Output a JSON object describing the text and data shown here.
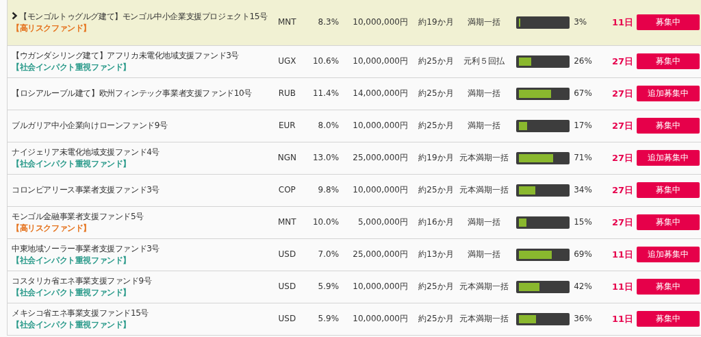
{
  "funds": [
    {
      "name": "【モンゴルトゥグルグ建て】モンゴル中小企業支援プロジェクト15号",
      "tag": {
        "kind": "high-risk",
        "text": "【高リスクファンド】"
      },
      "currency": "MNT",
      "rate": "8.3%",
      "amount": "10,000,000円",
      "period": "約19か月",
      "repayment": "満期一括",
      "level": 0.03,
      "percent": "3%",
      "days": "11日",
      "status": "募集中",
      "selected": true
    },
    {
      "name": "【ウガンダシリング建て】アフリカ未電化地域支援ファンド3号",
      "tag": {
        "kind": "social-impact",
        "text": "【社会インパクト重視ファンド】"
      },
      "currency": "UGX",
      "rate": "10.6%",
      "amount": "10,000,000円",
      "period": "約25か月",
      "repayment": "元利５回払",
      "level": 0.26,
      "percent": "26%",
      "days": "27日",
      "status": "募集中",
      "selected": false
    },
    {
      "name": "【ロシアルーブル建て】欧州フィンテック事業者支援ファンド10号",
      "currency": "RUB",
      "rate": "11.4%",
      "amount": "14,000,000円",
      "period": "約25か月",
      "repayment": "満期一括",
      "level": 0.67,
      "percent": "67%",
      "days": "27日",
      "status": "追加募集中",
      "selected": false
    },
    {
      "name": "ブルガリア中小企業向けローンファンド9号",
      "currency": "EUR",
      "rate": "8.0%",
      "amount": "10,000,000円",
      "period": "約25か月",
      "repayment": "満期一括",
      "level": 0.17,
      "percent": "17%",
      "days": "27日",
      "status": "募集中",
      "selected": false
    },
    {
      "name": "ナイジェリア未電化地域支援ファンド4号",
      "tag": {
        "kind": "social-impact",
        "text": "【社会インパクト重視ファンド】"
      },
      "currency": "NGN",
      "rate": "13.0%",
      "amount": "25,000,000円",
      "period": "約19か月",
      "repayment": "元本満期一括",
      "level": 0.71,
      "percent": "71%",
      "days": "27日",
      "status": "追加募集中",
      "selected": false
    },
    {
      "name": "コロンビアリース事業者支援ファンド3号",
      "currency": "COP",
      "rate": "9.8%",
      "amount": "10,000,000円",
      "period": "約25か月",
      "repayment": "元本満期一括",
      "level": 0.34,
      "percent": "34%",
      "days": "27日",
      "status": "募集中",
      "selected": false
    },
    {
      "name": "モンゴル金融事業者支援ファンド5号",
      "tag": {
        "kind": "high-risk",
        "text": "【高リスクファンド】"
      },
      "currency": "MNT",
      "rate": "10.0%",
      "amount": "5,000,000円",
      "period": "約16か月",
      "repayment": "満期一括",
      "level": 0.15,
      "percent": "15%",
      "days": "27日",
      "status": "募集中",
      "selected": false
    },
    {
      "name": "中東地域ソーラー事業者支援ファンド3号",
      "tag": {
        "kind": "social-impact",
        "text": "【社会インパクト重視ファンド】"
      },
      "currency": "USD",
      "rate": "7.0%",
      "amount": "25,000,000円",
      "period": "約13か月",
      "repayment": "満期一括",
      "level": 0.69,
      "percent": "69%",
      "days": "11日",
      "status": "追加募集中",
      "selected": false
    },
    {
      "name": "コスタリカ省エネ事業支援ファンド9号",
      "tag": {
        "kind": "social-impact",
        "text": "【社会インパクト重視ファンド】"
      },
      "currency": "USD",
      "rate": "5.9%",
      "amount": "10,000,000円",
      "period": "約25か月",
      "repayment": "元本満期一括",
      "level": 0.42,
      "percent": "42%",
      "days": "11日",
      "status": "募集中",
      "selected": false
    },
    {
      "name": "メキシコ省エネ事業支援ファンド15号",
      "tag": {
        "kind": "social-impact",
        "text": "【社会インパクト重視ファンド】"
      },
      "currency": "USD",
      "rate": "5.9%",
      "amount": "10,000,000円",
      "period": "約25か月",
      "repayment": "元本満期一括",
      "level": 0.36,
      "percent": "36%",
      "days": "11日",
      "status": "募集中",
      "selected": false
    }
  ]
}
